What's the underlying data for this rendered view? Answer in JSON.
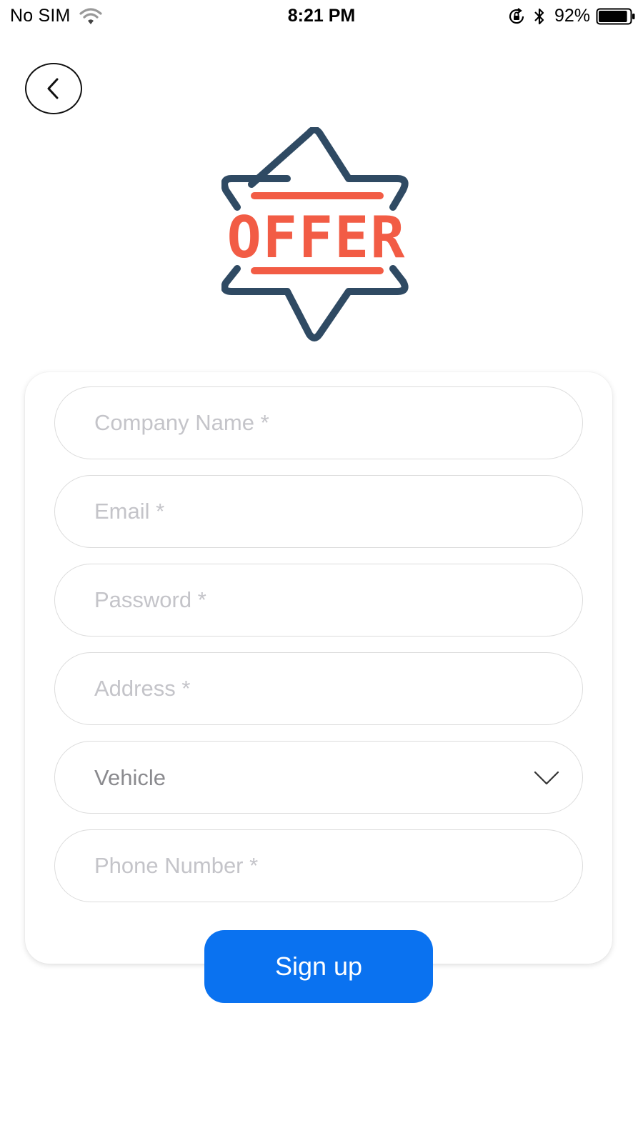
{
  "status_bar": {
    "carrier": "No SIM",
    "time": "8:21 PM",
    "battery_percent": "92%",
    "battery_level": 0.92,
    "icons": [
      "wifi-icon",
      "orientation-lock-icon",
      "bluetooth-icon",
      "battery-icon"
    ]
  },
  "header": {
    "back_icon": "back-arrow-icon"
  },
  "logo": {
    "text": "OFFER",
    "icon": "star-badge-icon",
    "star_color": "#2f4a63",
    "text_color": "#f25c45"
  },
  "form": {
    "company_name": {
      "placeholder": "Company Name *",
      "value": ""
    },
    "email": {
      "placeholder": "Email *",
      "value": ""
    },
    "password": {
      "placeholder": "Password *",
      "value": ""
    },
    "address": {
      "placeholder": "Address *",
      "value": ""
    },
    "vehicle": {
      "selected": "Vehicle",
      "icon": "chevron-down-icon"
    },
    "phone_number": {
      "placeholder": "Phone Number *",
      "value": ""
    }
  },
  "actions": {
    "signup_label": "Sign up",
    "signup_color": "#0a72f0"
  }
}
